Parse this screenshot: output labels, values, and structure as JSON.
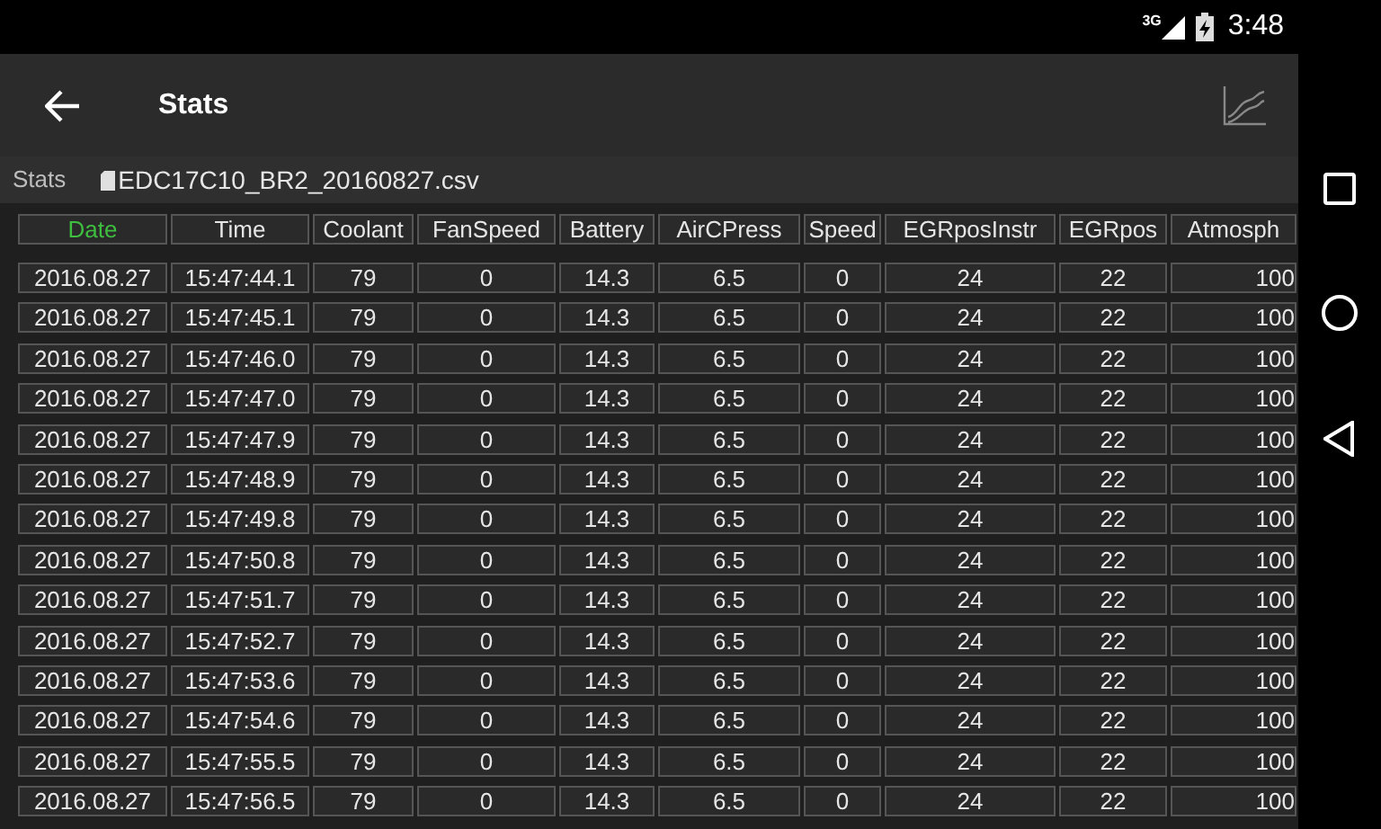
{
  "status_bar": {
    "network": "3G",
    "time": "3:48"
  },
  "app_bar": {
    "title": "Stats"
  },
  "file_bar": {
    "label": "Stats",
    "file": "EDC17C10_BR2_20160827.csv"
  },
  "table": {
    "columns": [
      {
        "label": "Date",
        "selected": true
      },
      {
        "label": "Time",
        "selected": false
      },
      {
        "label": "Coolant",
        "selected": false
      },
      {
        "label": "FanSpeed",
        "selected": false
      },
      {
        "label": "Battery",
        "selected": false
      },
      {
        "label": "AirCPress",
        "selected": false
      },
      {
        "label": "Speed",
        "selected": false
      },
      {
        "label": "EGRposInstr",
        "selected": false
      },
      {
        "label": "EGRpos",
        "selected": false
      },
      {
        "label": "Atmosph",
        "selected": false
      }
    ],
    "rows": [
      [
        "2016.08.27",
        "15:47:44.1",
        "79",
        "0",
        "14.3",
        "6.5",
        "0",
        "24",
        "22",
        "100"
      ],
      [
        "2016.08.27",
        "15:47:45.1",
        "79",
        "0",
        "14.3",
        "6.5",
        "0",
        "24",
        "22",
        "100"
      ],
      [
        "2016.08.27",
        "15:47:46.0",
        "79",
        "0",
        "14.3",
        "6.5",
        "0",
        "24",
        "22",
        "100"
      ],
      [
        "2016.08.27",
        "15:47:47.0",
        "79",
        "0",
        "14.3",
        "6.5",
        "0",
        "24",
        "22",
        "100"
      ],
      [
        "2016.08.27",
        "15:47:47.9",
        "79",
        "0",
        "14.3",
        "6.5",
        "0",
        "24",
        "22",
        "100"
      ],
      [
        "2016.08.27",
        "15:47:48.9",
        "79",
        "0",
        "14.3",
        "6.5",
        "0",
        "24",
        "22",
        "100"
      ],
      [
        "2016.08.27",
        "15:47:49.8",
        "79",
        "0",
        "14.3",
        "6.5",
        "0",
        "24",
        "22",
        "100"
      ],
      [
        "2016.08.27",
        "15:47:50.8",
        "79",
        "0",
        "14.3",
        "6.5",
        "0",
        "24",
        "22",
        "100"
      ],
      [
        "2016.08.27",
        "15:47:51.7",
        "79",
        "0",
        "14.3",
        "6.5",
        "0",
        "24",
        "22",
        "100"
      ],
      [
        "2016.08.27",
        "15:47:52.7",
        "79",
        "0",
        "14.3",
        "6.5",
        "0",
        "24",
        "22",
        "100"
      ],
      [
        "2016.08.27",
        "15:47:53.6",
        "79",
        "0",
        "14.3",
        "6.5",
        "0",
        "24",
        "22",
        "100"
      ],
      [
        "2016.08.27",
        "15:47:54.6",
        "79",
        "0",
        "14.3",
        "6.5",
        "0",
        "24",
        "22",
        "100"
      ],
      [
        "2016.08.27",
        "15:47:55.5",
        "79",
        "0",
        "14.3",
        "6.5",
        "0",
        "24",
        "22",
        "100"
      ],
      [
        "2016.08.27",
        "15:47:56.5",
        "79",
        "0",
        "14.3",
        "6.5",
        "0",
        "24",
        "22",
        "100"
      ]
    ]
  }
}
